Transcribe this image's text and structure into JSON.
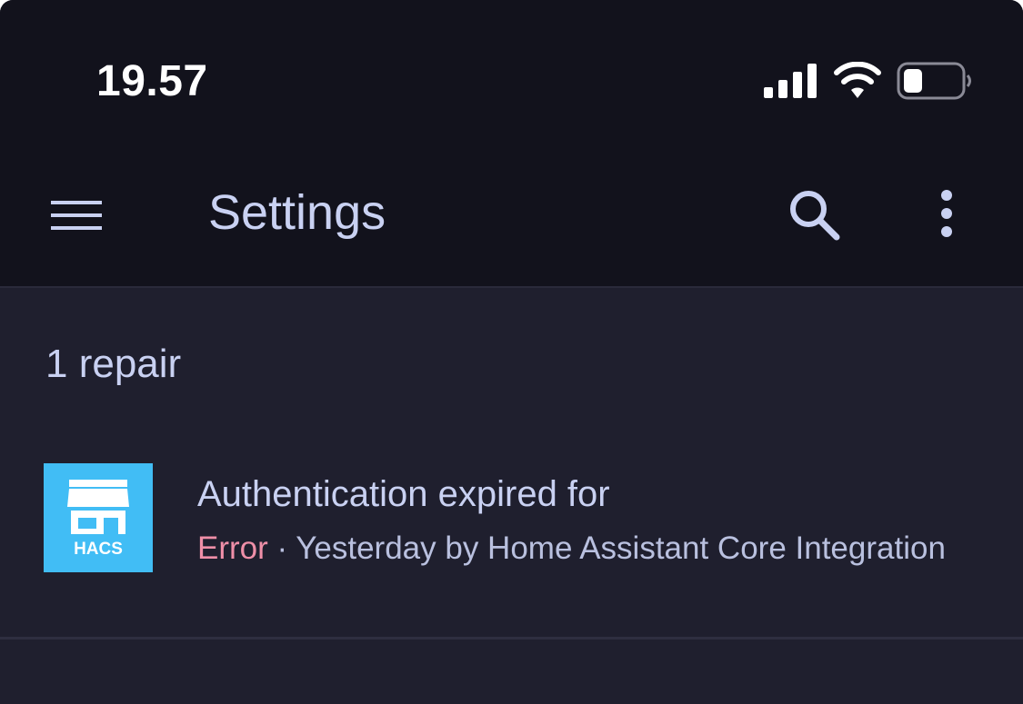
{
  "status_bar": {
    "time": "19.57",
    "icons": [
      "cellular-signal-icon",
      "wifi-icon",
      "battery-icon"
    ]
  },
  "app_bar": {
    "title": "Settings",
    "icons": [
      "menu-icon",
      "search-icon",
      "more-vert-icon"
    ]
  },
  "repairs": {
    "header": "1 repair",
    "items": [
      {
        "icon": "hacs-logo",
        "logo_text": "HACS",
        "title": "Authentication expired for",
        "severity": "Error",
        "separator": " · ",
        "detail": "Yesterday by Home Assistant Core Integration"
      }
    ]
  },
  "colors": {
    "background": "#1f1f2e",
    "app_bar": "#12121c",
    "text": "#c9d1f2",
    "error": "#ef8fa8",
    "hacs_blue": "#41bdf5"
  }
}
